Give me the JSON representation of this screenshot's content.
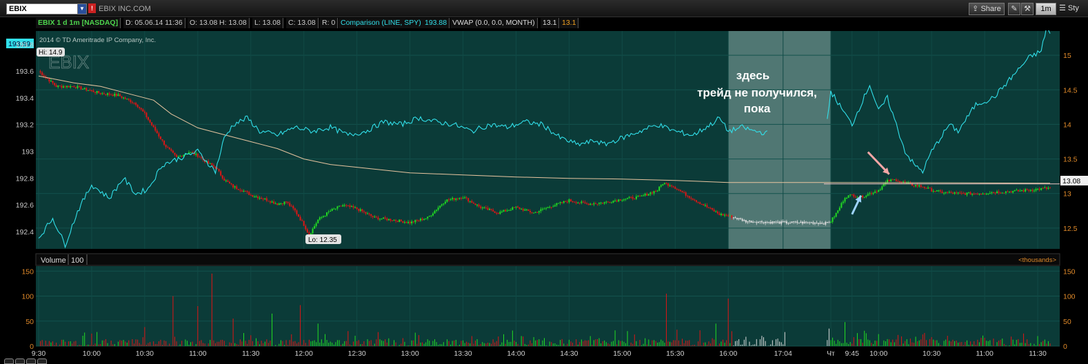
{
  "toolbar": {
    "symbol": "EBIX",
    "company": "EBIX INC.COM",
    "share_label": "Share",
    "timeframe_label": "1m",
    "style_label": "Sty",
    "icons": [
      "chevron-down-icon",
      "alert-icon",
      "share-icon",
      "wrench-icon",
      "drawing-icon"
    ]
  },
  "info_bar": {
    "symbol_label": "EBIX 1 d 1m [NASDAQ]",
    "date": "D: 05.06.14 11:36",
    "open": "O: 13.08",
    "high": "H: 13.08",
    "low": "L: 13.08",
    "close": "C: 13.08",
    "range": "R: 0",
    "comparison": "Comparison (LINE, SPY)",
    "comparison_value": "193.88",
    "vwap": "VWAP (0.0, 0.0, MONTH)",
    "vwap_value": "13.1",
    "vwap_value2": "13.1"
  },
  "colors": {
    "panel_bg": "#0b3b38",
    "up": "#22dd22",
    "down": "#e01515",
    "comparison": "#31e0ea",
    "vwap": "#e8c5a0",
    "axis": "#e08a2a",
    "left_axis": "#c8c8c8",
    "highlight": "#7a9c98"
  },
  "chart_data": [
    {
      "type": "candlestick",
      "watermark": "2014 © TD Ameritrade IP Company, Inc.",
      "watermark_symbol": "EBIX",
      "hi_label": "Hi: 14.9",
      "lo_label": "Lo: 12.35",
      "comparison_label": "193.89",
      "last_price_label": "13.08",
      "annotation_lines": [
        "здесь",
        "трейд не получился,",
        "пока"
      ],
      "right_axis": {
        "ticks": [
          "15",
          "14.5",
          "14",
          "13.5",
          "13",
          "12.5"
        ],
        "values": [
          15,
          14.5,
          14,
          13.5,
          13,
          12.5
        ],
        "ylim": [
          12.2,
          15.35
        ]
      },
      "left_axis": {
        "ticks": [
          "193.8",
          "193.6",
          "193.4",
          "193.2",
          "193",
          "192.8",
          "192.6",
          "192.4"
        ],
        "values": [
          193.8,
          193.6,
          193.4,
          193.2,
          193.0,
          192.8,
          192.6,
          192.4
        ],
        "ylim": [
          192.27,
          193.9
        ]
      },
      "x_ticks": [
        "9:30",
        "10:00",
        "10:30",
        "11:00",
        "11:30",
        "12:00",
        "12:30",
        "13:00",
        "13:30",
        "14:00",
        "14:30",
        "15:00",
        "15:30",
        "16:00",
        "17:04",
        "Чт",
        "9:45",
        "10:00",
        "10:30",
        "11:00",
        "11:30"
      ],
      "x_tick_index": [
        0,
        30,
        60,
        90,
        120,
        150,
        180,
        210,
        240,
        270,
        300,
        330,
        360,
        390,
        421,
        448,
        460,
        475,
        505,
        535,
        565
      ],
      "n_bars": 573,
      "highlight_range_index": [
        390,
        448
      ],
      "price_path": [
        [
          0,
          14.77
        ],
        [
          10,
          14.55
        ],
        [
          20,
          14.55
        ],
        [
          35,
          14.45
        ],
        [
          45,
          14.42
        ],
        [
          55,
          14.3
        ],
        [
          60,
          14.15
        ],
        [
          65,
          13.95
        ],
        [
          72,
          13.68
        ],
        [
          78,
          13.52
        ],
        [
          85,
          13.6
        ],
        [
          90,
          13.55
        ],
        [
          95,
          13.45
        ],
        [
          100,
          13.38
        ],
        [
          105,
          13.2
        ],
        [
          110,
          13.1
        ],
        [
          115,
          13.05
        ],
        [
          120,
          12.98
        ],
        [
          128,
          12.92
        ],
        [
          135,
          12.85
        ],
        [
          140,
          12.88
        ],
        [
          145,
          12.75
        ],
        [
          150,
          12.55
        ],
        [
          153,
          12.4
        ],
        [
          158,
          12.62
        ],
        [
          165,
          12.75
        ],
        [
          172,
          12.83
        ],
        [
          180,
          12.78
        ],
        [
          190,
          12.65
        ],
        [
          200,
          12.62
        ],
        [
          210,
          12.58
        ],
        [
          220,
          12.65
        ],
        [
          230,
          12.9
        ],
        [
          240,
          12.95
        ],
        [
          250,
          12.8
        ],
        [
          260,
          12.72
        ],
        [
          270,
          12.8
        ],
        [
          280,
          12.72
        ],
        [
          290,
          12.82
        ],
        [
          300,
          12.9
        ],
        [
          310,
          12.85
        ],
        [
          320,
          12.87
        ],
        [
          330,
          12.92
        ],
        [
          340,
          12.95
        ],
        [
          350,
          13.05
        ],
        [
          353,
          13.15
        ],
        [
          358,
          13.12
        ],
        [
          365,
          13.0
        ],
        [
          375,
          12.85
        ],
        [
          385,
          12.7
        ],
        [
          390,
          12.68
        ],
        [
          400,
          12.6
        ],
        [
          420,
          12.58
        ],
        [
          440,
          12.58
        ],
        [
          445,
          12.57
        ],
        [
          448,
          12.6
        ],
        [
          452,
          12.75
        ],
        [
          456,
          12.95
        ],
        [
          460,
          12.98
        ],
        [
          465,
          12.95
        ],
        [
          470,
          13.0
        ],
        [
          475,
          13.05
        ],
        [
          480,
          13.18
        ],
        [
          485,
          13.2
        ],
        [
          490,
          13.15
        ],
        [
          495,
          13.12
        ],
        [
          500,
          13.1
        ],
        [
          505,
          13.05
        ],
        [
          510,
          13.02
        ],
        [
          520,
          13.0
        ],
        [
          530,
          13.0
        ],
        [
          540,
          13.02
        ],
        [
          550,
          13.03
        ],
        [
          560,
          13.05
        ],
        [
          572,
          13.08
        ]
      ],
      "comparison_path": [
        [
          0,
          192.35
        ],
        [
          8,
          192.5
        ],
        [
          15,
          192.3
        ],
        [
          22,
          192.55
        ],
        [
          30,
          192.75
        ],
        [
          40,
          192.65
        ],
        [
          48,
          192.8
        ],
        [
          55,
          192.68
        ],
        [
          62,
          192.72
        ],
        [
          70,
          192.9
        ],
        [
          80,
          192.95
        ],
        [
          90,
          193.0
        ],
        [
          100,
          192.85
        ],
        [
          105,
          193.1
        ],
        [
          110,
          193.2
        ],
        [
          118,
          193.25
        ],
        [
          125,
          193.15
        ],
        [
          135,
          193.12
        ],
        [
          145,
          193.18
        ],
        [
          155,
          193.15
        ],
        [
          165,
          193.18
        ],
        [
          175,
          193.12
        ],
        [
          185,
          193.15
        ],
        [
          195,
          193.22
        ],
        [
          205,
          193.2
        ],
        [
          215,
          193.25
        ],
        [
          225,
          193.22
        ],
        [
          235,
          193.2
        ],
        [
          245,
          193.15
        ],
        [
          255,
          193.2
        ],
        [
          265,
          193.18
        ],
        [
          275,
          193.22
        ],
        [
          285,
          193.2
        ],
        [
          295,
          193.1
        ],
        [
          305,
          193.05
        ],
        [
          315,
          193.08
        ],
        [
          320,
          193.05
        ],
        [
          330,
          193.1
        ],
        [
          340,
          193.15
        ],
        [
          350,
          193.2
        ],
        [
          360,
          193.15
        ],
        [
          370,
          193.12
        ],
        [
          380,
          193.2
        ],
        [
          385,
          193.25
        ],
        [
          390,
          193.15
        ],
        [
          398,
          193.18
        ],
        [
          405,
          193.15
        ],
        [
          420,
          193.12
        ],
        [
          435,
          193.12
        ],
        [
          445,
          193.12
        ],
        [
          448,
          193.45
        ],
        [
          455,
          193.3
        ],
        [
          460,
          193.2
        ],
        [
          465,
          193.35
        ],
        [
          470,
          193.5
        ],
        [
          475,
          193.3
        ],
        [
          480,
          193.4
        ],
        [
          485,
          193.2
        ],
        [
          490,
          193.0
        ],
        [
          495,
          192.9
        ],
        [
          500,
          192.85
        ],
        [
          505,
          193.0
        ],
        [
          510,
          193.1
        ],
        [
          515,
          193.2
        ],
        [
          520,
          193.15
        ],
        [
          525,
          193.25
        ],
        [
          530,
          193.35
        ],
        [
          540,
          193.4
        ],
        [
          550,
          193.55
        ],
        [
          560,
          193.7
        ],
        [
          567,
          193.75
        ],
        [
          570,
          193.93
        ],
        [
          572,
          193.88
        ]
      ],
      "vwap_path": [
        [
          0,
          14.7
        ],
        [
          20,
          14.6
        ],
        [
          35,
          14.55
        ],
        [
          50,
          14.45
        ],
        [
          65,
          14.35
        ],
        [
          75,
          14.15
        ],
        [
          90,
          13.95
        ],
        [
          105,
          13.85
        ],
        [
          120,
          13.75
        ],
        [
          135,
          13.65
        ],
        [
          150,
          13.5
        ],
        [
          165,
          13.42
        ],
        [
          180,
          13.38
        ],
        [
          210,
          13.3
        ],
        [
          240,
          13.27
        ],
        [
          270,
          13.24
        ],
        [
          300,
          13.22
        ],
        [
          330,
          13.21
        ],
        [
          360,
          13.19
        ],
        [
          390,
          13.16
        ],
        [
          448,
          13.16
        ],
        [
          572,
          13.15
        ]
      ],
      "arrows": [
        {
          "from": [
            469,
            13.6
          ],
          "to": [
            481,
            13.28
          ],
          "color": "#f3a6a6"
        },
        {
          "from": [
            460,
            12.7
          ],
          "to": [
            465,
            12.97
          ],
          "color": "#9fd4ff"
        }
      ]
    },
    {
      "type": "bar",
      "title": "Volume",
      "period_label": "100",
      "unit_label": "<thousands>",
      "y_ticks": [
        "150",
        "100",
        "50",
        "0"
      ],
      "y_values": [
        150,
        100,
        50,
        0
      ],
      "ylim": [
        0,
        160
      ],
      "spikes": [
        [
          0,
          20
        ],
        [
          30,
          25
        ],
        [
          60,
          38
        ],
        [
          76,
          100
        ],
        [
          90,
          80
        ],
        [
          98,
          145
        ],
        [
          110,
          55
        ],
        [
          132,
          65
        ],
        [
          148,
          82
        ],
        [
          158,
          45
        ],
        [
          175,
          30
        ],
        [
          192,
          28
        ],
        [
          215,
          22
        ],
        [
          245,
          20
        ],
        [
          280,
          18
        ],
        [
          312,
          20
        ],
        [
          333,
          30
        ],
        [
          355,
          105
        ],
        [
          383,
          45
        ],
        [
          390,
          95
        ],
        [
          418,
          15
        ],
        [
          447,
          35
        ],
        [
          456,
          48
        ],
        [
          463,
          26
        ],
        [
          475,
          24
        ],
        [
          505,
          18
        ],
        [
          540,
          15
        ],
        [
          565,
          20
        ]
      ]
    }
  ]
}
